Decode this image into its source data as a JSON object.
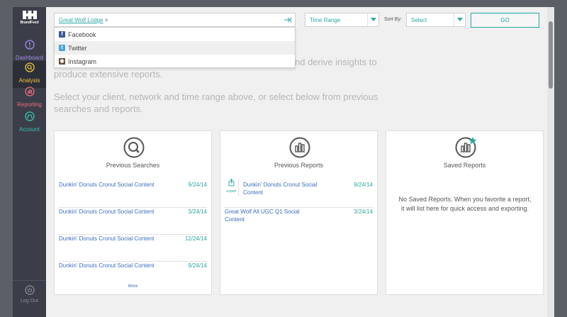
{
  "sidebar": {
    "logo_text": "BrandFeed",
    "items": [
      {
        "label": "Dashboard",
        "icon": "info-icon"
      },
      {
        "label": "Analysis",
        "icon": "search-icon"
      },
      {
        "label": "Reporting",
        "icon": "chart-icon"
      },
      {
        "label": "Account",
        "icon": "user-icon"
      }
    ],
    "logout_label": "Log Out"
  },
  "toolbar": {
    "client_link": "Great Wolf Lodge",
    "client_separator": ">",
    "networks": [
      {
        "label": "Facebook",
        "icon": "facebook-icon",
        "color": "#3b5998"
      },
      {
        "label": "Twitter",
        "icon": "twitter-icon",
        "color": "#4aa3df"
      },
      {
        "label": "Instagram",
        "icon": "instagram-icon",
        "color": "#6b4a3a"
      }
    ],
    "time_range": "Time Range",
    "sort_by_label": "Sort By:",
    "sort_value": "Select",
    "go_label": "GO"
  },
  "intro": {
    "line1": "nd derive insights to produce extensive reports.",
    "line1_a": "nd derive insights to",
    "line1_b": "produce extensive reports.",
    "line2_a": "Select your client, network and time range above, or select below from previous",
    "line2_b": "searches and reports."
  },
  "cards": {
    "previous_searches": {
      "title": "Previous Searches",
      "rows": [
        {
          "title": "Dunkin' Donuts Cronut Social Content",
          "date": "9/24/14"
        },
        {
          "title": "Dunkin' Donuts Cronut Social Content",
          "date": "3/24/14"
        },
        {
          "title": "Dunkin' Donuts Cronut Social Content",
          "date": "12/24/14"
        },
        {
          "title": "Dunkin' Donuts Cronut Social Content",
          "date": "9/24/14"
        }
      ],
      "more_label": "More"
    },
    "previous_reports": {
      "title": "Previous Reports",
      "export_label": "export",
      "rows": [
        {
          "title": "Dunkin' Donuts Cronut Social Content",
          "date": "9/24/14"
        },
        {
          "title": "Great Wolf All UGC Q1 Social Content",
          "date": "3/24/14"
        }
      ]
    },
    "saved_reports": {
      "title": "Saved Reports",
      "empty_message": "No Saved Reports. When you favorite a report, it will list here for quick access and exporting."
    }
  },
  "colors": {
    "accent": "#2aa7a0",
    "link": "#3c6ebd",
    "sidebar_bg": "#3b3e49"
  }
}
